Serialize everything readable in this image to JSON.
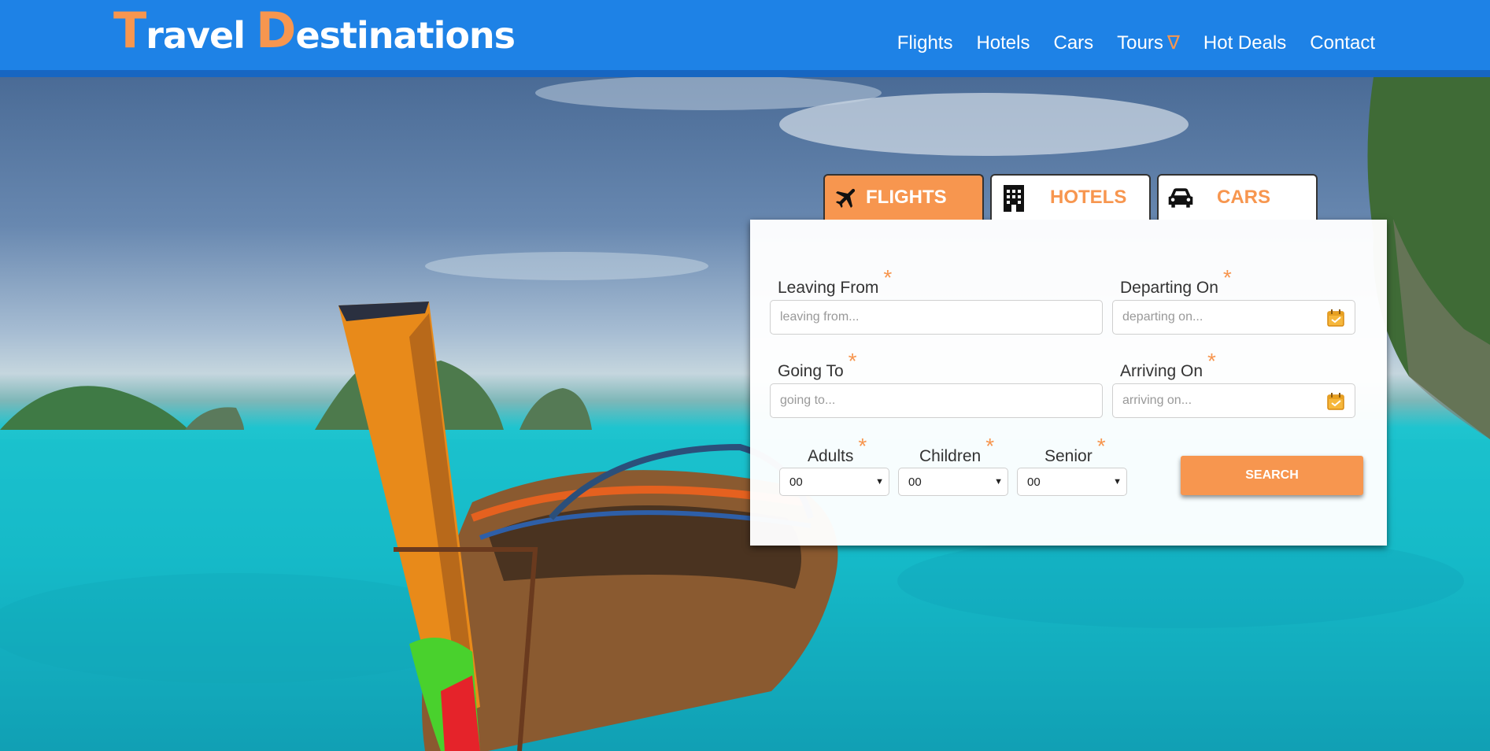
{
  "brand": {
    "t1": "T",
    "t2": "ravel",
    "t3": "D",
    "t4": "estinations"
  },
  "nav": {
    "items": [
      {
        "label": "Flights"
      },
      {
        "label": "Hotels"
      },
      {
        "label": "Cars"
      },
      {
        "label": "Tours",
        "caret": "∇"
      },
      {
        "label": "Hot Deals"
      },
      {
        "label": "Contact"
      }
    ]
  },
  "tabs": [
    {
      "label": "FLIGHTS",
      "icon": "airplane-icon",
      "active": true
    },
    {
      "label": "HOTELS",
      "icon": "building-icon",
      "active": false
    },
    {
      "label": "CARS",
      "icon": "car-icon",
      "active": false
    }
  ],
  "form": {
    "required_mark": "*",
    "leaving_from": {
      "label": "Leaving From",
      "placeholder": "leaving from..."
    },
    "departing_on": {
      "label": "Departing On",
      "placeholder": "departing on...",
      "icon": "calendar-icon"
    },
    "going_to": {
      "label": "Going To",
      "placeholder": "going to..."
    },
    "arriving_on": {
      "label": "Arriving On",
      "placeholder": "arriving on...",
      "icon": "calendar-icon"
    },
    "adults": {
      "label": "Adults",
      "value": "00"
    },
    "children": {
      "label": "Children",
      "value": "00"
    },
    "senior": {
      "label": "Senior",
      "value": "00"
    },
    "search_label": "SEARCH"
  },
  "colors": {
    "header_blue": "#1e82e6",
    "accent_orange": "#f7964f"
  }
}
